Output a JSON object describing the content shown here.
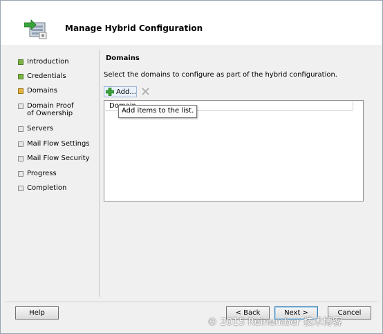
{
  "header": {
    "title": "Manage Hybrid Configuration"
  },
  "steps": [
    {
      "label": "Introduction",
      "state": "done"
    },
    {
      "label": "Credentials",
      "state": "done"
    },
    {
      "label": "Domains",
      "state": "current"
    },
    {
      "label": "Domain Proof of Ownership",
      "state": "pending"
    },
    {
      "label": "Servers",
      "state": "pending"
    },
    {
      "label": "Mail Flow Settings",
      "state": "pending"
    },
    {
      "label": "Mail Flow Security",
      "state": "pending"
    },
    {
      "label": "Progress",
      "state": "pending"
    },
    {
      "label": "Completion",
      "state": "pending"
    }
  ],
  "main": {
    "section_title": "Domains",
    "instruction": "Select the domains to configure as part of the hybrid configuration.",
    "add_label": "Add...",
    "list_column": "Domain",
    "tooltip": "Add items to the list."
  },
  "buttons": {
    "help": "Help",
    "back": "< Back",
    "next": "Next >",
    "cancel": "Cancel"
  },
  "watermark": "© 2015 Reinember 技术博客",
  "colors": {
    "done": "#7cb342",
    "current": "#e3b340",
    "pending": "#e6e6e6"
  }
}
